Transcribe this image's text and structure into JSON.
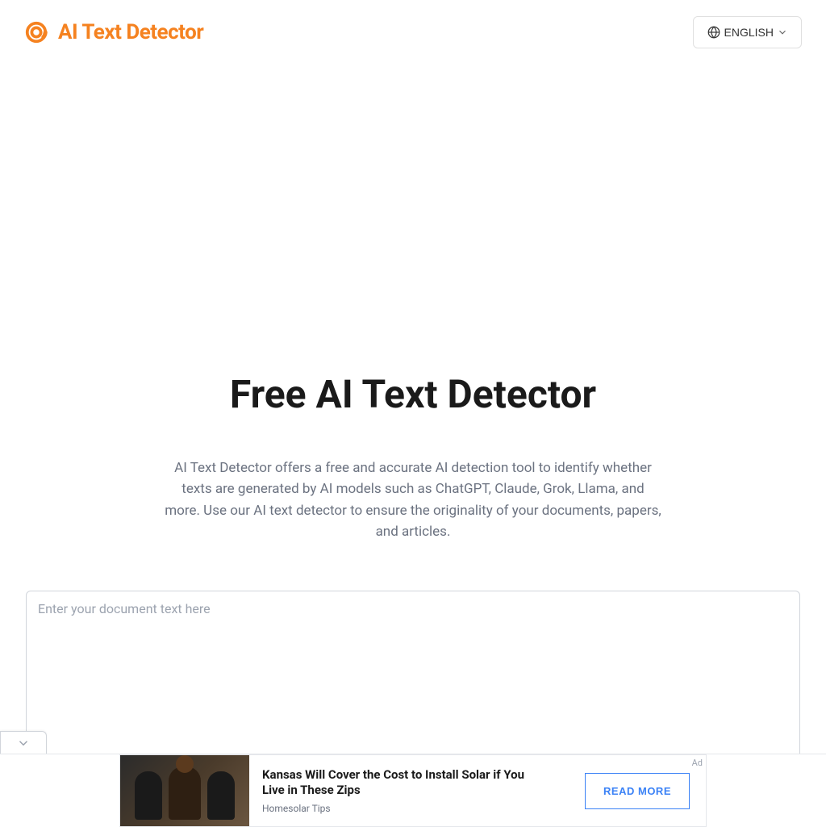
{
  "header": {
    "brand": "AI Text Detector",
    "language_label": "ENGLISH"
  },
  "hero": {
    "title": "Free AI Text Detector",
    "subtitle": "AI Text Detector offers a free and accurate AI detection tool to identify whether texts are generated by AI models such as ChatGPT, Claude, Grok, Llama, and more. Use our AI text detector to ensure the originality of your documents, papers, and articles."
  },
  "input": {
    "placeholder": "Enter your document text here"
  },
  "ad": {
    "label": "Ad",
    "headline": "Kansas Will Cover the Cost to Install Solar if You Live in These Zips",
    "source": "Homesolar Tips",
    "cta": "READ MORE"
  }
}
